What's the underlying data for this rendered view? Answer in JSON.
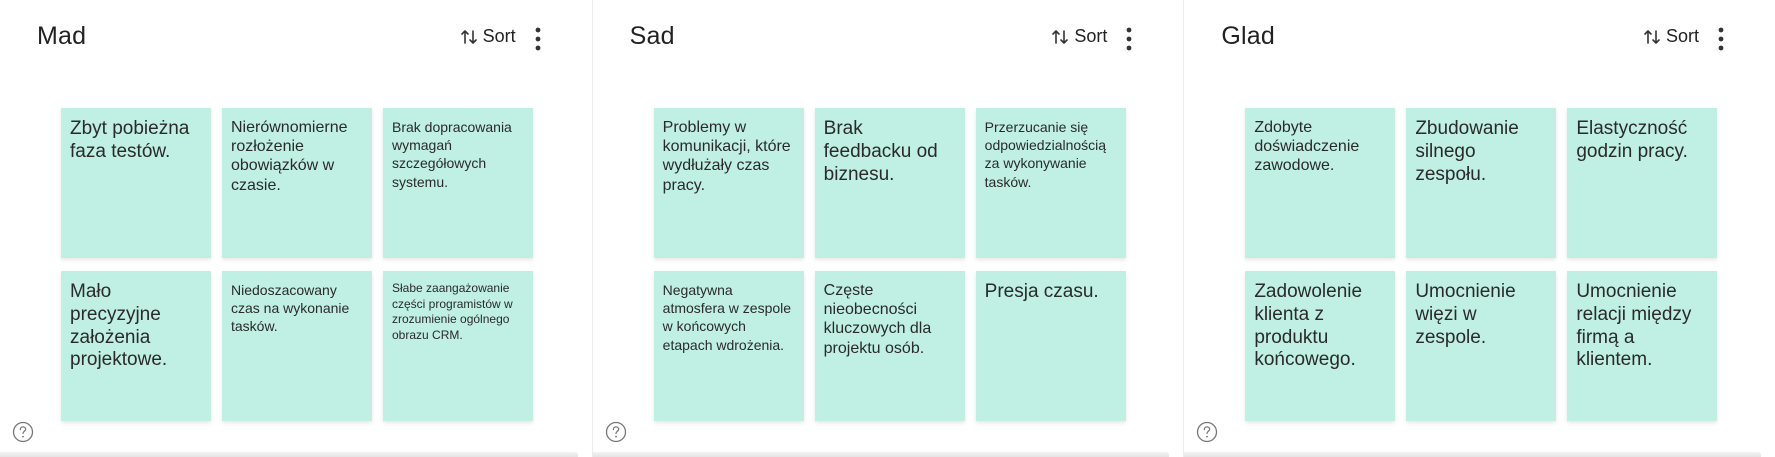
{
  "sort_label": "Sort",
  "columns": [
    {
      "title": "Mad",
      "notes": [
        {
          "text": "Zbyt pobieżna faza testów.",
          "size": "l"
        },
        {
          "text": "Nierównomierne rozłożenie obowiązków w czasie.",
          "size": "m"
        },
        {
          "text": "Brak dopracowania wymagań szczegółowych systemu.",
          "size": "s"
        },
        {
          "text": "Mało precyzyjne założenia projektowe.",
          "size": "l"
        },
        {
          "text": "Niedoszacowany czas na wykonanie tasków.",
          "size": "s"
        },
        {
          "text": "Słabe zaangażowanie części programistów w zrozumienie ogólnego obrazu CRM.",
          "size": "xs"
        }
      ]
    },
    {
      "title": "Sad",
      "notes": [
        {
          "text": "Problemy w komunikacji, które wydłużały czas pracy.",
          "size": "m"
        },
        {
          "text": "Brak feedbacku od biznesu.",
          "size": "l"
        },
        {
          "text": "Przerzucanie się odpowiedzialnością za wykonywanie tasków.",
          "size": "s"
        },
        {
          "text": "Negatywna atmosfera w zespole w końcowych etapach wdrożenia.",
          "size": "s"
        },
        {
          "text": "Częste nieobecności kluczowych dla projektu osób.",
          "size": "m"
        },
        {
          "text": "Presja czasu.",
          "size": "l"
        }
      ]
    },
    {
      "title": "Glad",
      "notes": [
        {
          "text": "Zdobyte doświadczenie zawodowe.",
          "size": "m"
        },
        {
          "text": "Zbudowanie silnego zespołu.",
          "size": "l"
        },
        {
          "text": "Elastyczność godzin pracy.",
          "size": "l"
        },
        {
          "text": "Zadowolenie klienta z produktu końcowego.",
          "size": "l"
        },
        {
          "text": "Umocnienie więzi w zespole.",
          "size": "l"
        },
        {
          "text": "Umocnienie relacji między firmą a klientem.",
          "size": "l"
        }
      ]
    }
  ],
  "colors": {
    "note_bg": "#bff0e3",
    "text": "#222222",
    "icon": "#555555"
  },
  "icons": {
    "sort": "sort-arrows-icon",
    "more": "more-vertical-icon",
    "help": "help-circle-icon"
  }
}
